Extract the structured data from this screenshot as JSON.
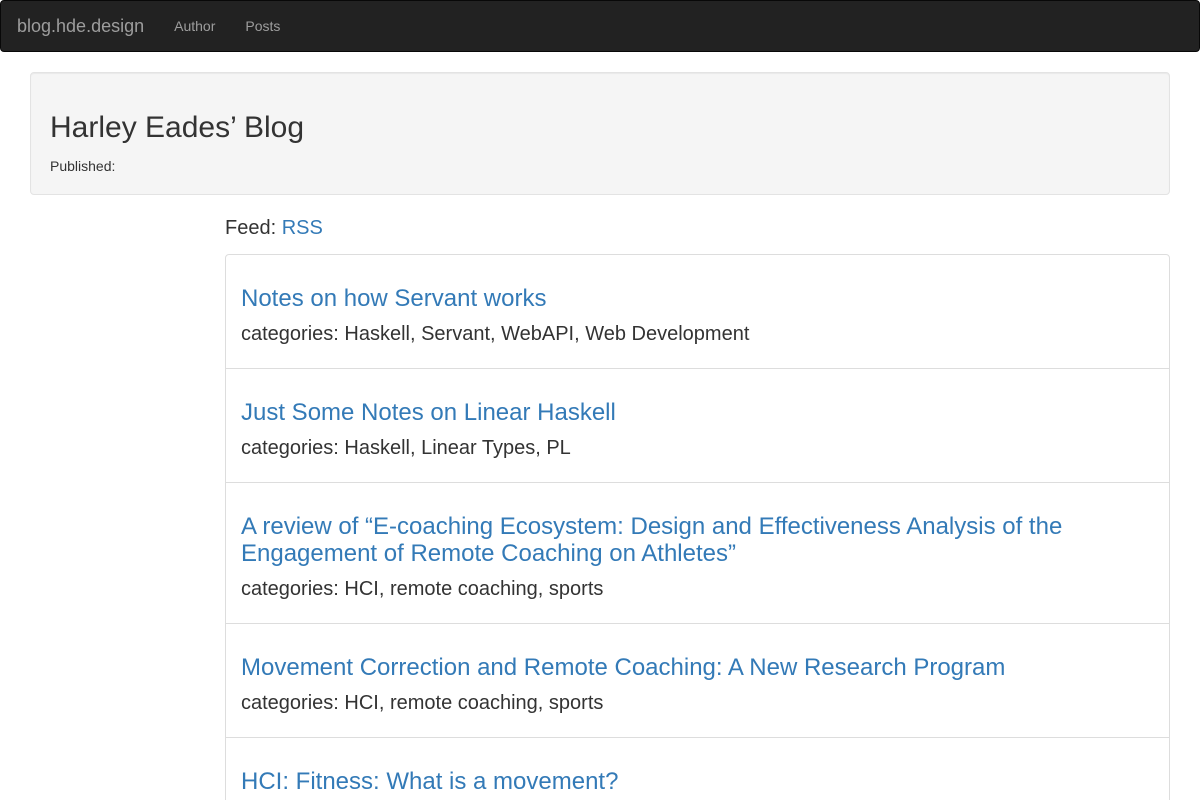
{
  "navbar": {
    "brand": "blog.hde.design",
    "links": [
      "Author",
      "Posts"
    ]
  },
  "header": {
    "title": "Harley Eades’ Blog",
    "published_label": "Published:"
  },
  "feed": {
    "label": "Feed: ",
    "link": "RSS"
  },
  "posts": [
    {
      "title": "Notes on how Servant works",
      "categories": "categories: Haskell, Servant, WebAPI, Web Development"
    },
    {
      "title": "Just Some Notes on Linear Haskell",
      "categories": "categories: Haskell, Linear Types, PL"
    },
    {
      "title": "A review of “E-coaching Ecosystem: Design and Effectiveness Analysis of the Engagement of Remote Coaching on Athletes”",
      "categories": "categories: HCI, remote coaching, sports"
    },
    {
      "title": "Movement Correction and Remote Coaching: A New Research Program",
      "categories": "categories: HCI, remote coaching, sports"
    },
    {
      "title": "HCI: Fitness: What is a movement?",
      "categories": ""
    }
  ],
  "colors": {
    "navbar_bg": "#222222",
    "link": "#337ab7",
    "jumbotron_bg": "#f5f5f5"
  }
}
